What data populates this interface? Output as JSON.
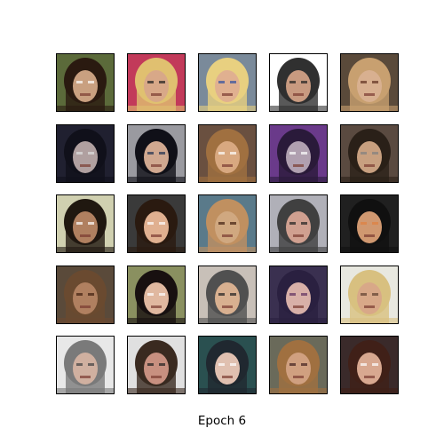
{
  "figure": {
    "caption": "Epoch 6",
    "rows": 5,
    "columns": 5,
    "tiles": [
      {
        "bg": "#5b6a3a",
        "hair": "#2a1a10",
        "skin": "#c9a080",
        "accent": "#ffffff"
      },
      {
        "bg": "#c23a5a",
        "hair": "#e0c070",
        "skin": "#d8a888",
        "accent": "#202020"
      },
      {
        "bg": "#7a8a9a",
        "hair": "#e8d080",
        "skin": "#e0b090",
        "accent": "#3050a0"
      },
      {
        "bg": "#ffffff",
        "hair": "#303030",
        "skin": "#c89a80",
        "accent": "#202020"
      },
      {
        "bg": "#5a4a3a",
        "hair": "#c8a070",
        "skin": "#d8b090",
        "accent": "#603020"
      },
      {
        "bg": "#202030",
        "hair": "#10101a",
        "skin": "#b0a0a0",
        "accent": "#e0e0e0"
      },
      {
        "bg": "#9a9aa0",
        "hair": "#101018",
        "skin": "#d0a890",
        "accent": "#203050"
      },
      {
        "bg": "#6a5040",
        "hair": "#a07040",
        "skin": "#d8a880",
        "accent": "#ffffff"
      },
      {
        "bg": "#6a3a8a",
        "hair": "#2a1a3a",
        "skin": "#b0a0b0",
        "accent": "#ffffff"
      },
      {
        "bg": "#5a4a40",
        "hair": "#2a2018",
        "skin": "#c8a080",
        "accent": "#808080"
      },
      {
        "bg": "#d0d0b0",
        "hair": "#201810",
        "skin": "#b08060",
        "accent": "#ffffff"
      },
      {
        "bg": "#3a3a3a",
        "hair": "#2a1a10",
        "skin": "#e0b090",
        "accent": "#ffffff"
      },
      {
        "bg": "#5a7a8a",
        "hair": "#c09060",
        "skin": "#d0a880",
        "accent": "#402010"
      },
      {
        "bg": "#b0b0b8",
        "hair": "#404040",
        "skin": "#d0a090",
        "accent": "#202020"
      },
      {
        "bg": "#202020",
        "hair": "#101010",
        "skin": "#d09870",
        "accent": "#e08040"
      },
      {
        "bg": "#5a4a3a",
        "hair": "#6a4a30",
        "skin": "#b08060",
        "accent": "#402010"
      },
      {
        "bg": "#8a9060",
        "hair": "#181010",
        "skin": "#e0b8a0",
        "accent": "#ffffff"
      },
      {
        "bg": "#c8c0b8",
        "hair": "#505050",
        "skin": "#d8b090",
        "accent": "#202020"
      },
      {
        "bg": "#3a3050",
        "hair": "#2a2040",
        "skin": "#d8b0a8",
        "accent": "#603060"
      },
      {
        "bg": "#e8e8e0",
        "hair": "#d8c080",
        "skin": "#d8a888",
        "accent": "#604030"
      },
      {
        "bg": "#e8e8e8",
        "hair": "#7a7a7a",
        "skin": "#d0b0a0",
        "accent": "#404040"
      },
      {
        "bg": "#e0e0e0",
        "hair": "#3a2a20",
        "skin": "#c89080",
        "accent": "#202020"
      },
      {
        "bg": "#2a5050",
        "hair": "#202830",
        "skin": "#e0c0b0",
        "accent": "#ffffff"
      },
      {
        "bg": "#6a6a5a",
        "hair": "#a07040",
        "skin": "#d0a080",
        "accent": "#402020"
      },
      {
        "bg": "#3a2a2a",
        "hair": "#402018",
        "skin": "#d8a890",
        "accent": "#ffffff"
      }
    ]
  }
}
